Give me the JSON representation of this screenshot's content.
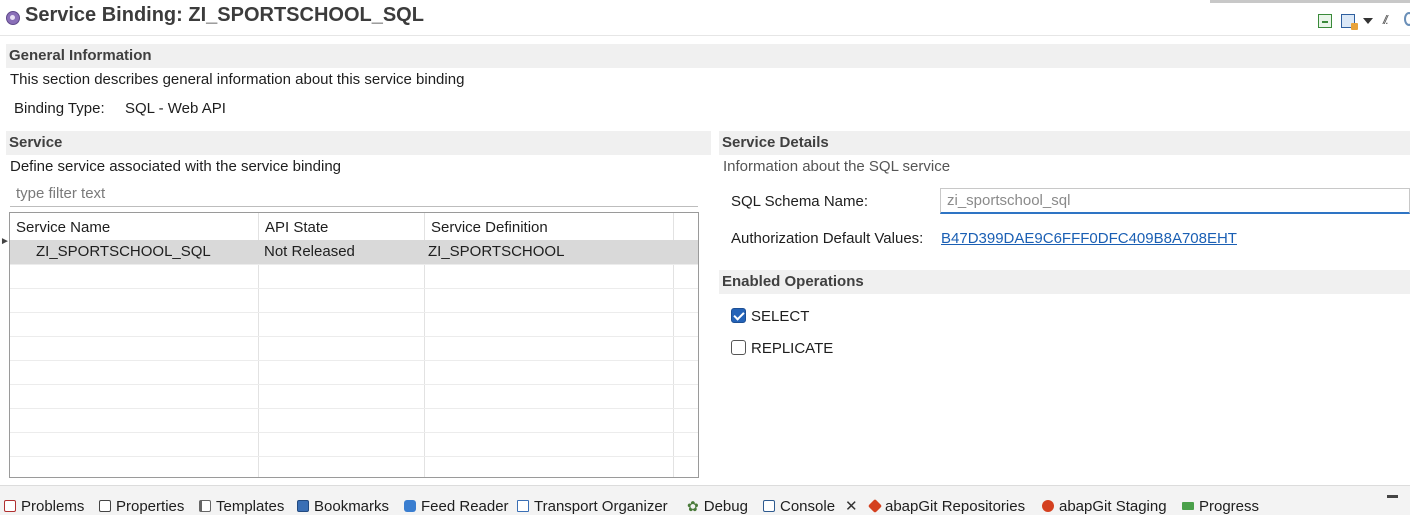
{
  "title": "Service Binding: ZI_SPORTSCHOOL_SQL",
  "general": {
    "header": "General Information",
    "description": "This section describes general information about this service binding",
    "binding_type_label": "Binding Type:",
    "binding_type_value": "SQL - Web API"
  },
  "service": {
    "header": "Service",
    "description": "Define service associated with the service binding",
    "filter_placeholder": "type filter text",
    "columns": [
      "Service Name",
      "API State",
      "Service Definition"
    ],
    "rows": [
      {
        "service_name": "ZI_SPORTSCHOOL_SQL",
        "api_state": "Not Released",
        "service_definition": "ZI_SPORTSCHOOL"
      }
    ]
  },
  "details": {
    "header": "Service Details",
    "description": "Information about the SQL service",
    "schema_label": "SQL Schema Name:",
    "schema_value": "zi_sportschool_sql",
    "auth_label": "Authorization Default Values:",
    "auth_value": "B47D399DAE9C6FFF0DFC409B8A708EHT"
  },
  "enabled_operations": {
    "header": "Enabled Operations",
    "select": {
      "label": "SELECT",
      "checked": true
    },
    "replicate": {
      "label": "REPLICATE",
      "checked": false
    }
  },
  "bottom_tabs": [
    {
      "label": "Problems",
      "icon": "problems-icon"
    },
    {
      "label": "Properties",
      "icon": "properties-icon"
    },
    {
      "label": "Templates",
      "icon": "templates-icon"
    },
    {
      "label": "Bookmarks",
      "icon": "bookmarks-icon"
    },
    {
      "label": "Feed Reader",
      "icon": "feed-reader-icon"
    },
    {
      "label": "Transport Organizer",
      "icon": "transport-organizer-icon"
    },
    {
      "label": "Debug",
      "icon": "debug-icon"
    },
    {
      "label": "Console",
      "icon": "console-icon",
      "active": true
    },
    {
      "label": "abapGit Repositories",
      "icon": "abapgit-repos-icon"
    },
    {
      "label": "abapGit Staging",
      "icon": "abapgit-staging-icon"
    },
    {
      "label": "Progress",
      "icon": "progress-icon"
    }
  ],
  "colors": {
    "section_header_bg": "#f0f0f0",
    "link": "#1a5fb4",
    "checkbox_checked": "#2463b8",
    "selected_row": "#d9d9d9",
    "focus_underline": "#2e74c4"
  }
}
